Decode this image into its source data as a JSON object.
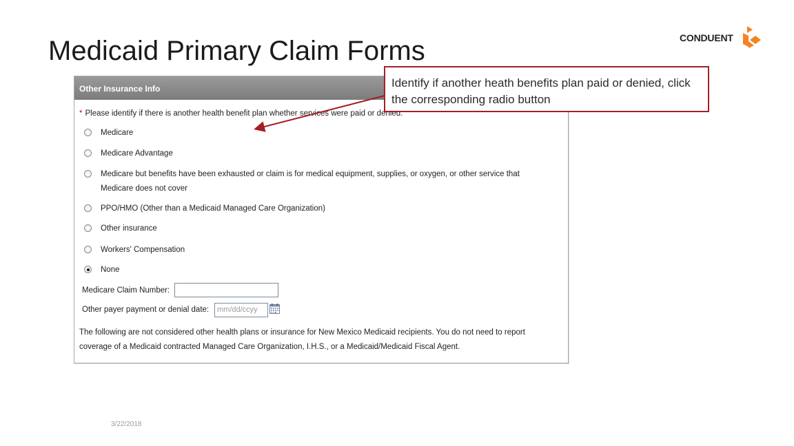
{
  "slide": {
    "title": "Medicaid Primary Claim Forms",
    "date": "3/22/2018"
  },
  "logo": {
    "text": "CONDUENT",
    "color": "#f58220"
  },
  "panel": {
    "header": "Other Insurance Info",
    "required_marker": "*",
    "prompt": "Please identify if there is another health benefit plan whether services were paid or denied.",
    "options": [
      {
        "label": "Medicare",
        "selected": false
      },
      {
        "label": "Medicare Advantage",
        "selected": false
      },
      {
        "label": "Medicare but benefits have been exhausted or claim is for medical equipment, supplies, or oxygen, or other service that",
        "label_line2": "Medicare does not cover",
        "selected": false
      },
      {
        "label": "PPO/HMO (Other than a Medicaid Managed Care Organization)",
        "selected": false
      },
      {
        "label": "Other insurance",
        "selected": false
      },
      {
        "label": "Workers' Compensation",
        "selected": false
      },
      {
        "label": "None",
        "selected": true
      }
    ],
    "medicare_claim_number": {
      "label": "Medicare Claim Number:",
      "value": ""
    },
    "denial_date": {
      "label": "Other payer payment or denial date:",
      "placeholder": "mm/dd/ccyy"
    },
    "note_line1": "The following are not considered other health plans or insurance for New Mexico Medicaid recipients. You do not need to report",
    "note_line2": "coverage of a Medicaid contracted Managed Care Organization, I.H.S., or a Medicaid/Medicaid Fiscal Agent."
  },
  "callout": {
    "text": "Identify if another heath benefits plan paid or denied, click the corresponding radio button",
    "border_color": "#a31f24"
  }
}
